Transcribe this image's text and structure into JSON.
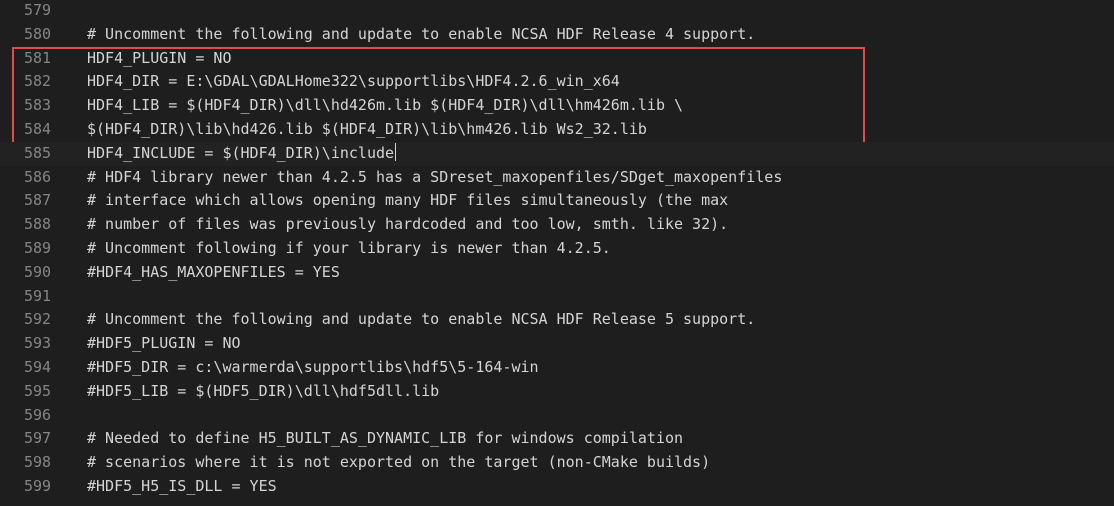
{
  "editor": {
    "lines": [
      {
        "number": "579",
        "text": ""
      },
      {
        "number": "580",
        "text": "# Uncomment the following and update to enable NCSA HDF Release 4 support."
      },
      {
        "number": "581",
        "text": "HDF4_PLUGIN = NO"
      },
      {
        "number": "582",
        "text": "HDF4_DIR = E:\\GDAL\\GDALHome322\\supportlibs\\HDF4.2.6_win_x64"
      },
      {
        "number": "583",
        "text": "HDF4_LIB = $(HDF4_DIR)\\dll\\hd426m.lib $(HDF4_DIR)\\dll\\hm426m.lib \\"
      },
      {
        "number": "584",
        "text": "$(HDF4_DIR)\\lib\\hd426.lib $(HDF4_DIR)\\lib\\hm426.lib Ws2_32.lib"
      },
      {
        "number": "585",
        "text": "HDF4_INCLUDE = $(HDF4_DIR)\\include"
      },
      {
        "number": "586",
        "text": "# HDF4 library newer than 4.2.5 has a SDreset_maxopenfiles/SDget_maxopenfiles"
      },
      {
        "number": "587",
        "text": "# interface which allows opening many HDF files simultaneously (the max"
      },
      {
        "number": "588",
        "text": "# number of files was previously hardcoded and too low, smth. like 32)."
      },
      {
        "number": "589",
        "text": "# Uncomment following if your library is newer than 4.2.5."
      },
      {
        "number": "590",
        "text": "#HDF4_HAS_MAXOPENFILES = YES"
      },
      {
        "number": "591",
        "text": ""
      },
      {
        "number": "592",
        "text": "# Uncomment the following and update to enable NCSA HDF Release 5 support."
      },
      {
        "number": "593",
        "text": "#HDF5_PLUGIN = NO"
      },
      {
        "number": "594",
        "text": "#HDF5_DIR = c:\\warmerda\\supportlibs\\hdf5\\5-164-win"
      },
      {
        "number": "595",
        "text": "#HDF5_LIB = $(HDF5_DIR)\\dll\\hdf5dll.lib"
      },
      {
        "number": "596",
        "text": ""
      },
      {
        "number": "597",
        "text": "# Needed to define H5_BUILT_AS_DYNAMIC_LIB for windows compilation"
      },
      {
        "number": "598",
        "text": "# scenarios where it is not exported on the target (non-CMake builds)"
      },
      {
        "number": "599",
        "text": "#HDF5_H5_IS_DLL = YES"
      }
    ],
    "highlight": {
      "from_line": "581",
      "to_line": "585",
      "color": "#e04b4b"
    },
    "current_line": "585",
    "colors": {
      "background": "#1e1e1e",
      "text": "#d4d4d4",
      "line_number": "#858585"
    }
  }
}
